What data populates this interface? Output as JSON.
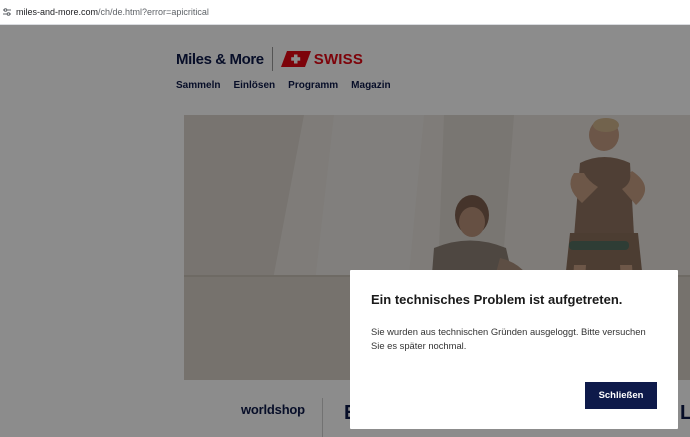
{
  "browser": {
    "url_host": "miles-and-more.com",
    "url_path": "/ch/de.html?error=apicritical"
  },
  "brand": {
    "primary_logo": "Miles & More",
    "partner_logo": "SWISS"
  },
  "nav": {
    "items": [
      {
        "label": "Sammeln"
      },
      {
        "label": "Einlösen"
      },
      {
        "label": "Programm"
      },
      {
        "label": "Magazin"
      }
    ]
  },
  "promo_strip": {
    "worldshop_logo": "worldshop",
    "partial_left": "E",
    "partial_right": "LL"
  },
  "modal": {
    "title": "Ein technisches Problem ist aufgetreten.",
    "message": "Sie wurden aus technischen Gründen ausgeloggt. Bitte versuchen Sie es später nochmal.",
    "close_label": "Schließen"
  },
  "colors": {
    "navy": "#0e1a4a",
    "swiss_red": "#e30613",
    "overlay": "rgba(0,0,0,0.45)"
  },
  "icons": {
    "address_bar": "tune-icon",
    "partner": "swiss-flag-icon"
  }
}
